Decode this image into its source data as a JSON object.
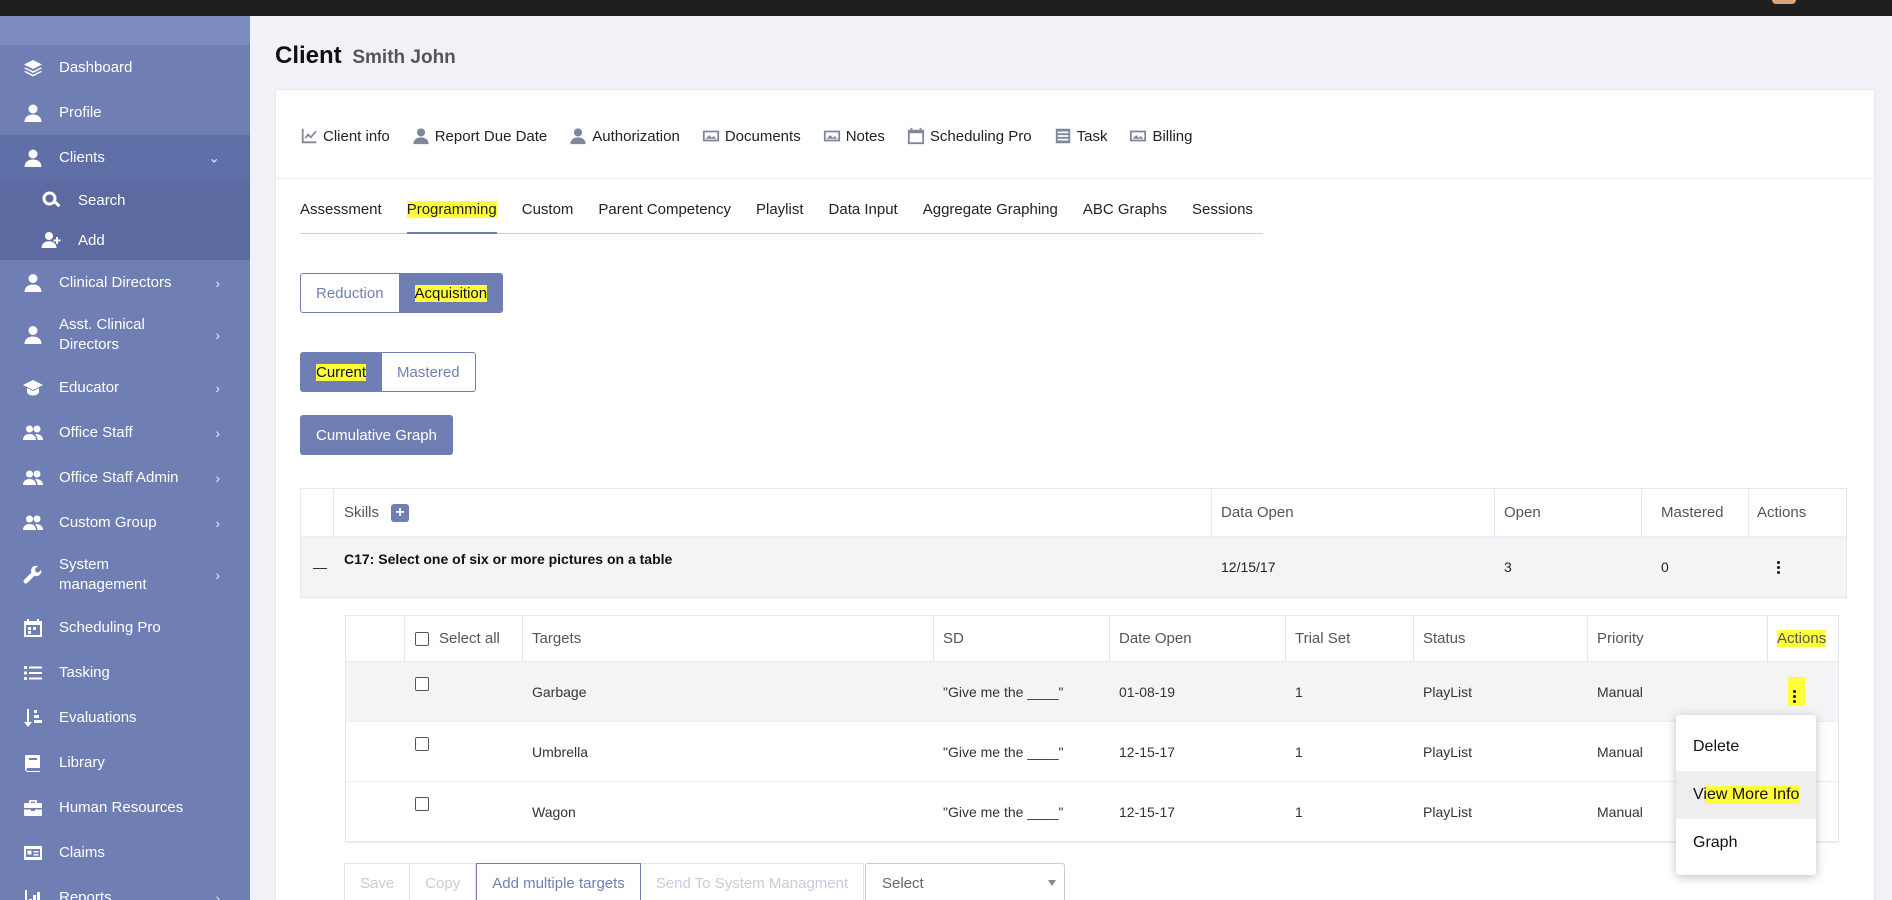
{
  "sidebar": {
    "items": [
      {
        "label": "Dashboard",
        "icon": "layers-icon"
      },
      {
        "label": "Profile",
        "icon": "user-icon"
      },
      {
        "label": "Clients",
        "icon": "user-icon",
        "expanded": true
      },
      {
        "label": "Clinical Directors",
        "icon": "user-tie-icon"
      },
      {
        "label": "Asst. Clinical Directors",
        "icon": "user-tie-icon"
      },
      {
        "label": "Educator",
        "icon": "graduation-cap-icon"
      },
      {
        "label": "Office Staff",
        "icon": "users-icon"
      },
      {
        "label": "Office Staff Admin",
        "icon": "users-icon"
      },
      {
        "label": "Custom Group",
        "icon": "users-icon"
      },
      {
        "label": "System management",
        "icon": "wrench-icon"
      },
      {
        "label": "Scheduling Pro",
        "icon": "calendar-icon"
      },
      {
        "label": "Tasking",
        "icon": "list-icon"
      },
      {
        "label": "Evaluations",
        "icon": "sort-icon"
      },
      {
        "label": "Library",
        "icon": "book-icon"
      },
      {
        "label": "Human Resources",
        "icon": "briefcase-icon"
      },
      {
        "label": "Claims",
        "icon": "id-card-icon"
      },
      {
        "label": "Reports",
        "icon": "chart-icon"
      }
    ],
    "clients_sub": [
      {
        "label": "Search",
        "icon": "search-icon"
      },
      {
        "label": "Add",
        "icon": "user-plus-icon"
      }
    ]
  },
  "header": {
    "title": "Client",
    "subtitle": "Smith John"
  },
  "topnav": [
    {
      "label": "Client info",
      "icon": "chart-icon"
    },
    {
      "label": "Report Due Date",
      "icon": "user-icon"
    },
    {
      "label": "Authorization",
      "icon": "user-icon"
    },
    {
      "label": "Documents",
      "icon": "image-icon"
    },
    {
      "label": "Notes",
      "icon": "image-icon"
    },
    {
      "label": "Scheduling Pro",
      "icon": "calendar-icon"
    },
    {
      "label": "Task",
      "icon": "list-icon"
    },
    {
      "label": "Billing",
      "icon": "image-icon"
    }
  ],
  "tabs": [
    "Assessment",
    "Programming",
    "Custom",
    "Parent Competency",
    "Playlist",
    "Data Input",
    "Aggregate Graphing",
    "ABC Graphs",
    "Sessions"
  ],
  "active_tab": "Programming",
  "type_toggle": {
    "options": [
      "Reduction",
      "Acquisition"
    ],
    "selected": "Acquisition"
  },
  "status_toggle": {
    "options": [
      "Current",
      "Mastered"
    ],
    "selected": "Current"
  },
  "cumulative_button": "Cumulative Graph",
  "skills_table": {
    "headers": {
      "skills": "Skills",
      "data_open": "Data Open",
      "open": "Open",
      "mastered": "Mastered",
      "actions": "Actions"
    },
    "row": {
      "collapse": "—",
      "title": "C17: Select one of six or more pictures on a table",
      "data_open": "12/15/17",
      "open": "3",
      "mastered": "0"
    }
  },
  "targets_table": {
    "headers": {
      "select_all": "Select all",
      "targets": "Targets",
      "sd": "SD",
      "date_open": "Date Open",
      "trial_set": "Trial Set",
      "status": "Status",
      "priority": "Priority",
      "actions": "Actions"
    },
    "rows": [
      {
        "target": "Garbage",
        "sd": "\"Give me the ____\"",
        "date_open": "01-08-19",
        "trial_set": "1",
        "status": "PlayList",
        "priority": "Manual"
      },
      {
        "target": "Umbrella",
        "sd": "\"Give me the ____\"",
        "date_open": "12-15-17",
        "trial_set": "1",
        "status": "PlayList",
        "priority": "Manual"
      },
      {
        "target": "Wagon",
        "sd": "\"Give me the ____\"",
        "date_open": "12-15-17",
        "trial_set": "1",
        "status": "PlayList",
        "priority": "Manual"
      }
    ]
  },
  "bottom_actions": {
    "save": "Save",
    "copy": "Copy",
    "add_multiple": "Add multiple targets",
    "send": "Send To System Managment",
    "select_placeholder": "Select"
  },
  "row_menu": {
    "delete": "Delete",
    "view_more": "View More Info",
    "graph": "Graph"
  },
  "colors": {
    "sidebar": "#6f7fb4",
    "accent": "#6f7fb4",
    "highlight": "#ffff3a"
  }
}
